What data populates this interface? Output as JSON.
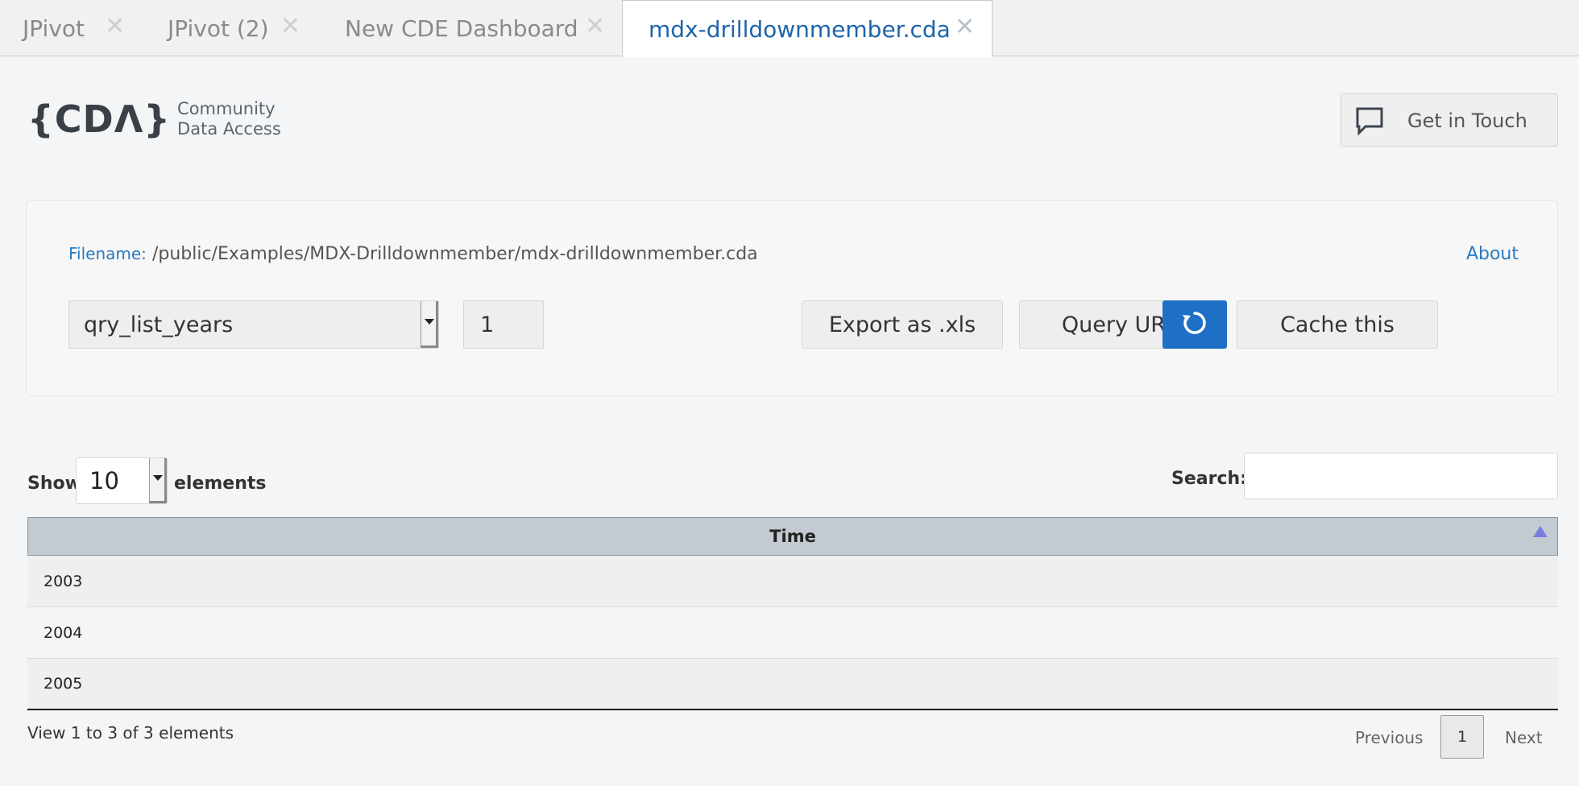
{
  "tabs": [
    {
      "label": "JPivot",
      "active": false
    },
    {
      "label": "JPivot (2)",
      "active": false
    },
    {
      "label": "New CDE Dashboard",
      "active": false
    },
    {
      "label": "mdx-drilldownmember.cda",
      "active": true
    }
  ],
  "tab_close_glyph": "✕",
  "header": {
    "logo_mark": "{CDΛ}",
    "logo_line1": "Community",
    "logo_line2": "Data Access",
    "contact_label": "Get in Touch",
    "contact_icon": "chat-bubble-icon"
  },
  "panel": {
    "filename_key": "Filename:",
    "filename_value": "/public/Examples/MDX-Drilldownmember/mdx-drilldownmember.cda",
    "about_label": "About",
    "query_selected": "qry_list_years",
    "page_value": "1",
    "export_label": "Export as .xls",
    "query_url_label": "Query URL",
    "cache_label": "Cache this",
    "refresh_icon": "refresh-icon",
    "accent_color": "#1e6fc6"
  },
  "table_controls": {
    "show_label": "Show",
    "show_value": "10",
    "elements_label": "elements",
    "search_label": "Search:",
    "search_value": ""
  },
  "table": {
    "columns": [
      "Time"
    ],
    "sort": "ascending",
    "rows": [
      [
        "2003"
      ],
      [
        "2004"
      ],
      [
        "2005"
      ]
    ]
  },
  "footer": {
    "info": "View 1 to 3 of 3 elements",
    "prev_label": "Previous",
    "current_page": "1",
    "next_label": "Next"
  }
}
